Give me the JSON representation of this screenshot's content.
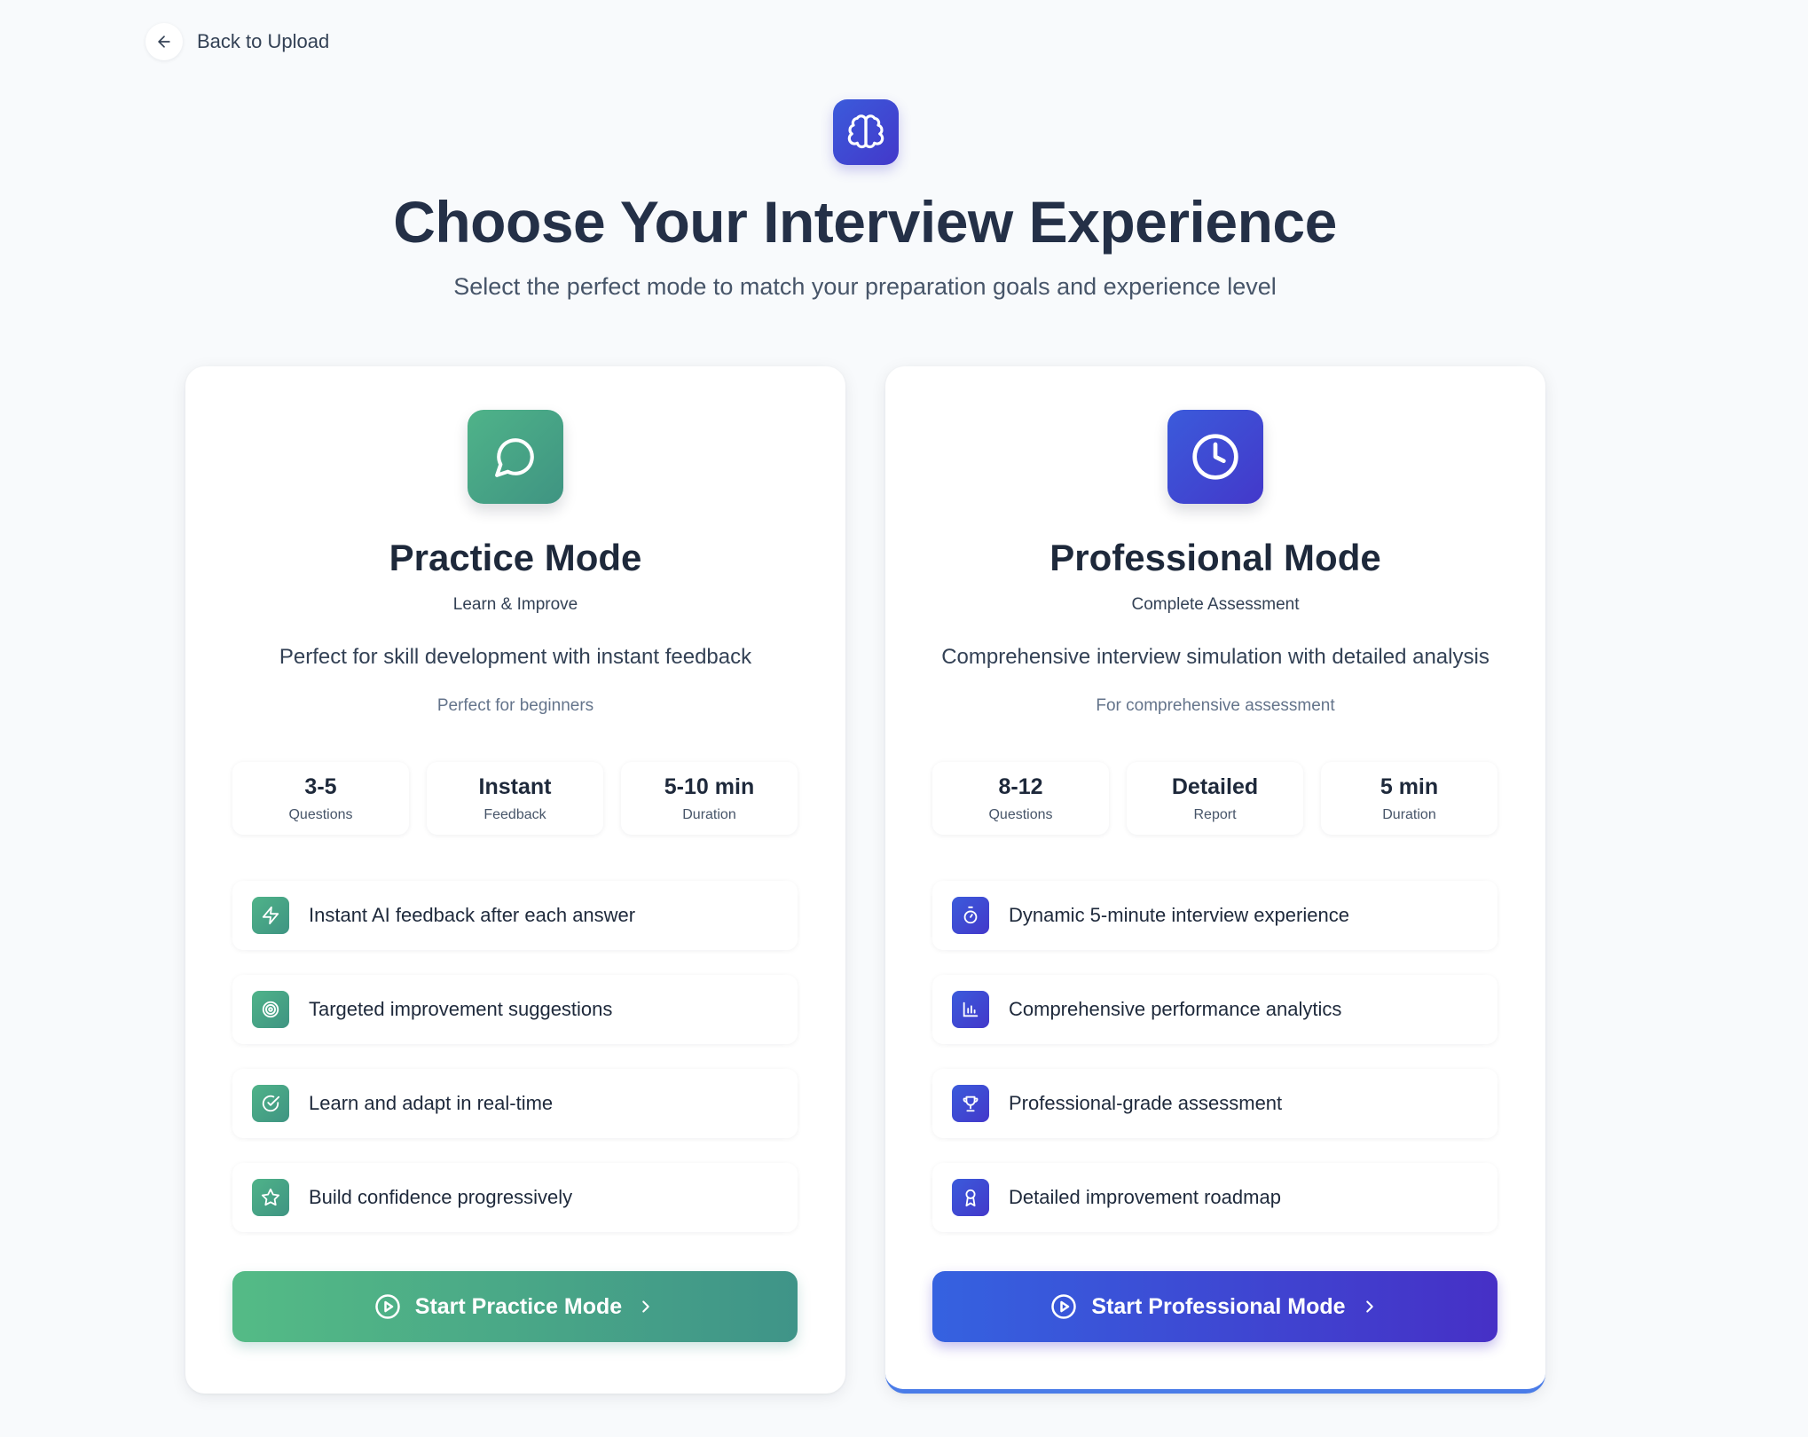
{
  "back": {
    "label": "Back to Upload",
    "icon": "arrow-left-icon"
  },
  "header": {
    "logo_icon": "brain-icon",
    "title": "Choose Your Interview Experience",
    "subtitle": "Select the perfect mode to match your preparation goals and experience level"
  },
  "colors": {
    "practice_accent": "#4fa888",
    "professional_accent": "#4338ca",
    "professional_border": "#4a7ce8",
    "page_bg": "#f8fafc"
  },
  "modes": [
    {
      "icon": "chat-bubble-icon",
      "title": "Practice Mode",
      "tag": "Learn & Improve",
      "description": "Perfect for skill development with instant feedback",
      "audience": "Perfect for beginners",
      "stats": [
        {
          "value": "3-5",
          "label": "Questions"
        },
        {
          "value": "Instant",
          "label": "Feedback"
        },
        {
          "value": "5-10 min",
          "label": "Duration"
        }
      ],
      "features": [
        {
          "icon": "lightning-icon",
          "text": "Instant AI feedback after each answer"
        },
        {
          "icon": "target-icon",
          "text": "Targeted improvement suggestions"
        },
        {
          "icon": "check-circle-icon",
          "text": "Learn and adapt in real-time"
        },
        {
          "icon": "star-icon",
          "text": "Build confidence progressively"
        }
      ],
      "cta": "Start Practice Mode"
    },
    {
      "icon": "clock-icon",
      "title": "Professional Mode",
      "tag": "Complete Assessment",
      "description": "Comprehensive interview simulation with detailed analysis",
      "audience": "For comprehensive assessment",
      "stats": [
        {
          "value": "8-12",
          "label": "Questions"
        },
        {
          "value": "Detailed",
          "label": "Report"
        },
        {
          "value": "5 min",
          "label": "Duration"
        }
      ],
      "features": [
        {
          "icon": "stopwatch-icon",
          "text": "Dynamic 5-minute interview experience"
        },
        {
          "icon": "bar-chart-icon",
          "text": "Comprehensive performance analytics"
        },
        {
          "icon": "trophy-icon",
          "text": "Professional-grade assessment"
        },
        {
          "icon": "award-icon",
          "text": "Detailed improvement roadmap"
        }
      ],
      "cta": "Start Professional Mode"
    }
  ]
}
